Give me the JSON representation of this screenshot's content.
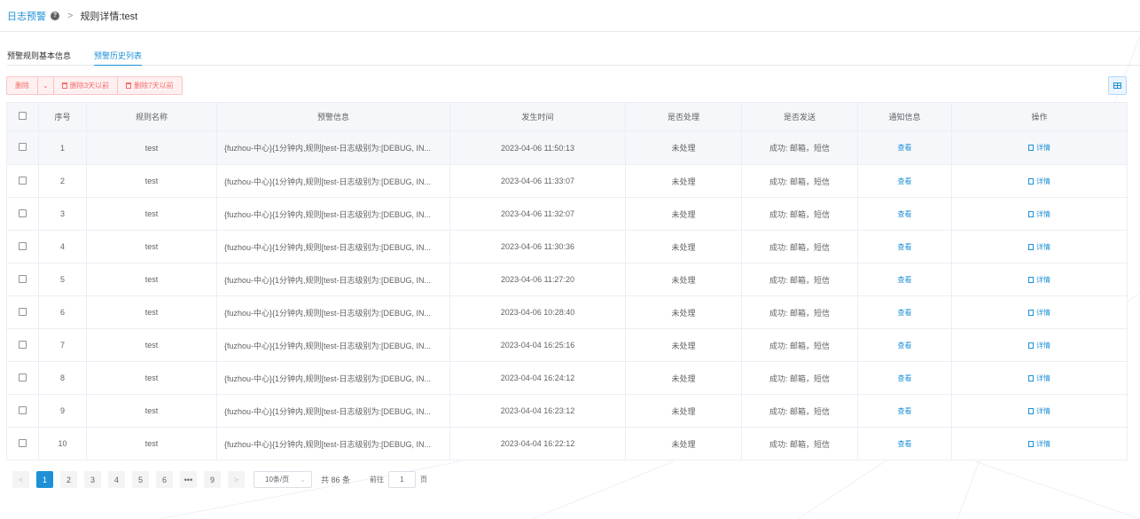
{
  "header": {
    "title": "日志预警",
    "help": "?",
    "separator": ">",
    "breadcrumb": "规则详情:test"
  },
  "tabs": [
    {
      "label": "预警规则基本信息",
      "active": false
    },
    {
      "label": "预警历史列表",
      "active": true
    }
  ],
  "toolbar": {
    "delete_label": "删除",
    "caret": "⌄",
    "delete3_label": "删除3天以前",
    "delete7_label": "删除7天以前"
  },
  "table": {
    "columns": [
      "",
      "序号",
      "规则名称",
      "预警信息",
      "发生时间",
      "是否处理",
      "是否发送",
      "通知信息",
      "操作"
    ],
    "rows": [
      {
        "no": "1",
        "rule": "test",
        "msg": "{fuzhou-中心}{1分钟内,规则[test-日志级别为:[DEBUG, IN...",
        "time": "2023-04-06 11:50:13",
        "handled": "未处理",
        "sent": "成功: 邮箱，短信",
        "notify": "查看",
        "action": "详情"
      },
      {
        "no": "2",
        "rule": "test",
        "msg": "{fuzhou-中心}{1分钟内,规则[test-日志级别为:[DEBUG, IN...",
        "time": "2023-04-06 11:33:07",
        "handled": "未处理",
        "sent": "成功: 邮箱，短信",
        "notify": "查看",
        "action": "详情"
      },
      {
        "no": "3",
        "rule": "test",
        "msg": "{fuzhou-中心}{1分钟内,规则[test-日志级别为:[DEBUG, IN...",
        "time": "2023-04-06 11:32:07",
        "handled": "未处理",
        "sent": "成功: 邮箱，短信",
        "notify": "查看",
        "action": "详情"
      },
      {
        "no": "4",
        "rule": "test",
        "msg": "{fuzhou-中心}{1分钟内,规则[test-日志级别为:[DEBUG, IN...",
        "time": "2023-04-06 11:30:36",
        "handled": "未处理",
        "sent": "成功: 邮箱，短信",
        "notify": "查看",
        "action": "详情"
      },
      {
        "no": "5",
        "rule": "test",
        "msg": "{fuzhou-中心}{1分钟内,规则[test-日志级别为:[DEBUG, IN...",
        "time": "2023-04-06 11:27:20",
        "handled": "未处理",
        "sent": "成功: 邮箱，短信",
        "notify": "查看",
        "action": "详情"
      },
      {
        "no": "6",
        "rule": "test",
        "msg": "{fuzhou-中心}{1分钟内,规则[test-日志级别为:[DEBUG, IN...",
        "time": "2023-04-06 10:28:40",
        "handled": "未处理",
        "sent": "成功: 邮箱，短信",
        "notify": "查看",
        "action": "详情"
      },
      {
        "no": "7",
        "rule": "test",
        "msg": "{fuzhou-中心}{1分钟内,规则[test-日志级别为:[DEBUG, IN...",
        "time": "2023-04-04 16:25:16",
        "handled": "未处理",
        "sent": "成功: 邮箱，短信",
        "notify": "查看",
        "action": "详情"
      },
      {
        "no": "8",
        "rule": "test",
        "msg": "{fuzhou-中心}{1分钟内,规则[test-日志级别为:[DEBUG, IN...",
        "time": "2023-04-04 16:24:12",
        "handled": "未处理",
        "sent": "成功: 邮箱，短信",
        "notify": "查看",
        "action": "详情"
      },
      {
        "no": "9",
        "rule": "test",
        "msg": "{fuzhou-中心}{1分钟内,规则[test-日志级别为:[DEBUG, IN...",
        "time": "2023-04-04 16:23:12",
        "handled": "未处理",
        "sent": "成功: 邮箱，短信",
        "notify": "查看",
        "action": "详情"
      },
      {
        "no": "10",
        "rule": "test",
        "msg": "{fuzhou-中心}{1分钟内,规则[test-日志级别为:[DEBUG, IN...",
        "time": "2023-04-04 16:22:12",
        "handled": "未处理",
        "sent": "成功: 邮箱，短信",
        "notify": "查看",
        "action": "详情"
      }
    ]
  },
  "pagination": {
    "prev": "<",
    "next": ">",
    "pages": [
      "1",
      "2",
      "3",
      "4",
      "5",
      "6",
      "•••",
      "9"
    ],
    "current": "1",
    "page_size": "10条/页",
    "total": "共 86 条",
    "goto_label": "前往",
    "goto_value": "1",
    "page_unit": "页"
  },
  "colors": {
    "accent": "#1e90d6",
    "danger": "#f56c6c",
    "header_bg": "#f5f7fa"
  }
}
